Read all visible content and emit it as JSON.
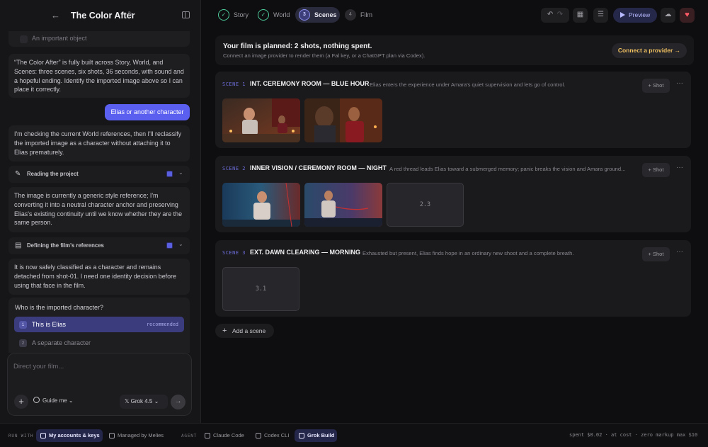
{
  "sidebar": {
    "back": "←",
    "title": "The Color After",
    "prev_option": {
      "num": "",
      "label": "An important object"
    },
    "msg1": "“The Color After” is fully built across Story, World, and Scenes: three scenes, six shots, 36 seconds, with sound and a hopeful ending. Identify the imported image above so I can place it correctly.",
    "user_msg": "Elias or another character",
    "msg2": "I'm checking the current World references, then I'll reclassify the imported image as a character without attaching it to Elias prematurely.",
    "step1": "Reading the project",
    "msg3": "The image is currently a generic style reference; I'm converting it into a neutral character anchor and preserving Elias's existing continuity until we know whether they are the same person.",
    "step2": "Defining the film's references",
    "msg4": "It is now safely classified as a character and remains detached from shot-01. I need one identity decision before using that face in the film.",
    "question": "Who is the imported character?",
    "options": [
      {
        "num": "1",
        "label": "This is Elias",
        "tag": "recommended"
      },
      {
        "num": "2",
        "label": "A separate character"
      }
    ],
    "composer_placeholder": "Direct your film...",
    "guide": "Guide me",
    "model": "Grok 4.5"
  },
  "tabs": [
    {
      "num": "✓",
      "label": "Story",
      "state": "done"
    },
    {
      "num": "✓",
      "label": "World",
      "state": "done"
    },
    {
      "num": "3",
      "label": "Scenes",
      "state": "active"
    },
    {
      "num": "4",
      "label": "Film",
      "state": "todo"
    }
  ],
  "toolbar": {
    "undo": "↶",
    "redo": "↷",
    "grid": "▦",
    "settings": "☰",
    "preview": "Preview",
    "cloud": "☁",
    "heart": "♥"
  },
  "banner": {
    "title": "Your film is planned: 2 shots, nothing spent.",
    "subtitle": "Connect an image provider to render them (a Fal key, or a ChatGPT plan via Codex).",
    "button": "Connect a provider →"
  },
  "scenes": [
    {
      "label": "SCENE 1",
      "heading": "INT. CEREMONY ROOM — BLUE HOUR",
      "desc": "Elias enters the experience under Amara's quiet supervision and lets go of control.",
      "shot_btn": "+ Shot",
      "placeholders": []
    },
    {
      "label": "SCENE 2",
      "heading": "INNER VISION / CEREMONY ROOM — NIGHT",
      "desc": "A red thread leads Elias toward a submerged memory; panic breaks the vision and Amara ground...",
      "shot_btn": "+ Shot",
      "placeholders": [
        "2.3"
      ]
    },
    {
      "label": "SCENE 3",
      "heading": "EXT. DAWN CLEARING — MORNING",
      "desc": "Exhausted but present, Elias finds hope in an ordinary new shoot and a complete breath.",
      "shot_btn": "+ Shot",
      "placeholders": [
        "3.1"
      ]
    }
  ],
  "add_scene": "Add a scene",
  "bottom": {
    "run_with": "RUN WITH",
    "my_accounts": "My accounts & keys",
    "managed": "Managed by Melies",
    "agent": "AGENT",
    "agents": [
      "Claude Code",
      "Codex CLI",
      "Grok Build"
    ],
    "spent": "spent $0.02 · at cost · zero markup   max $10"
  },
  "colors": {
    "accent": "#5b5ff0",
    "done": "#4ecb9a",
    "provider": "#f0c060",
    "heart": "#ff5a66"
  }
}
